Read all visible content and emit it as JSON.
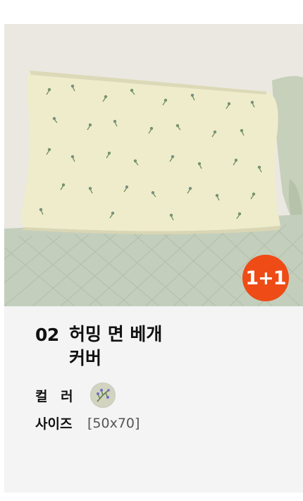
{
  "product": {
    "number": "02",
    "name": "허밍 면 베개커버",
    "badge": "1+1",
    "color_label": "컬 러",
    "color_swatch": "floral-sprig",
    "size_label": "사이즈",
    "size_value": "[50x70]"
  },
  "colors": {
    "badge": "#ee4b16",
    "pillow": "#eeeccb",
    "quilt": "#c3cfbc",
    "card_bg": "#f4f4f4"
  }
}
